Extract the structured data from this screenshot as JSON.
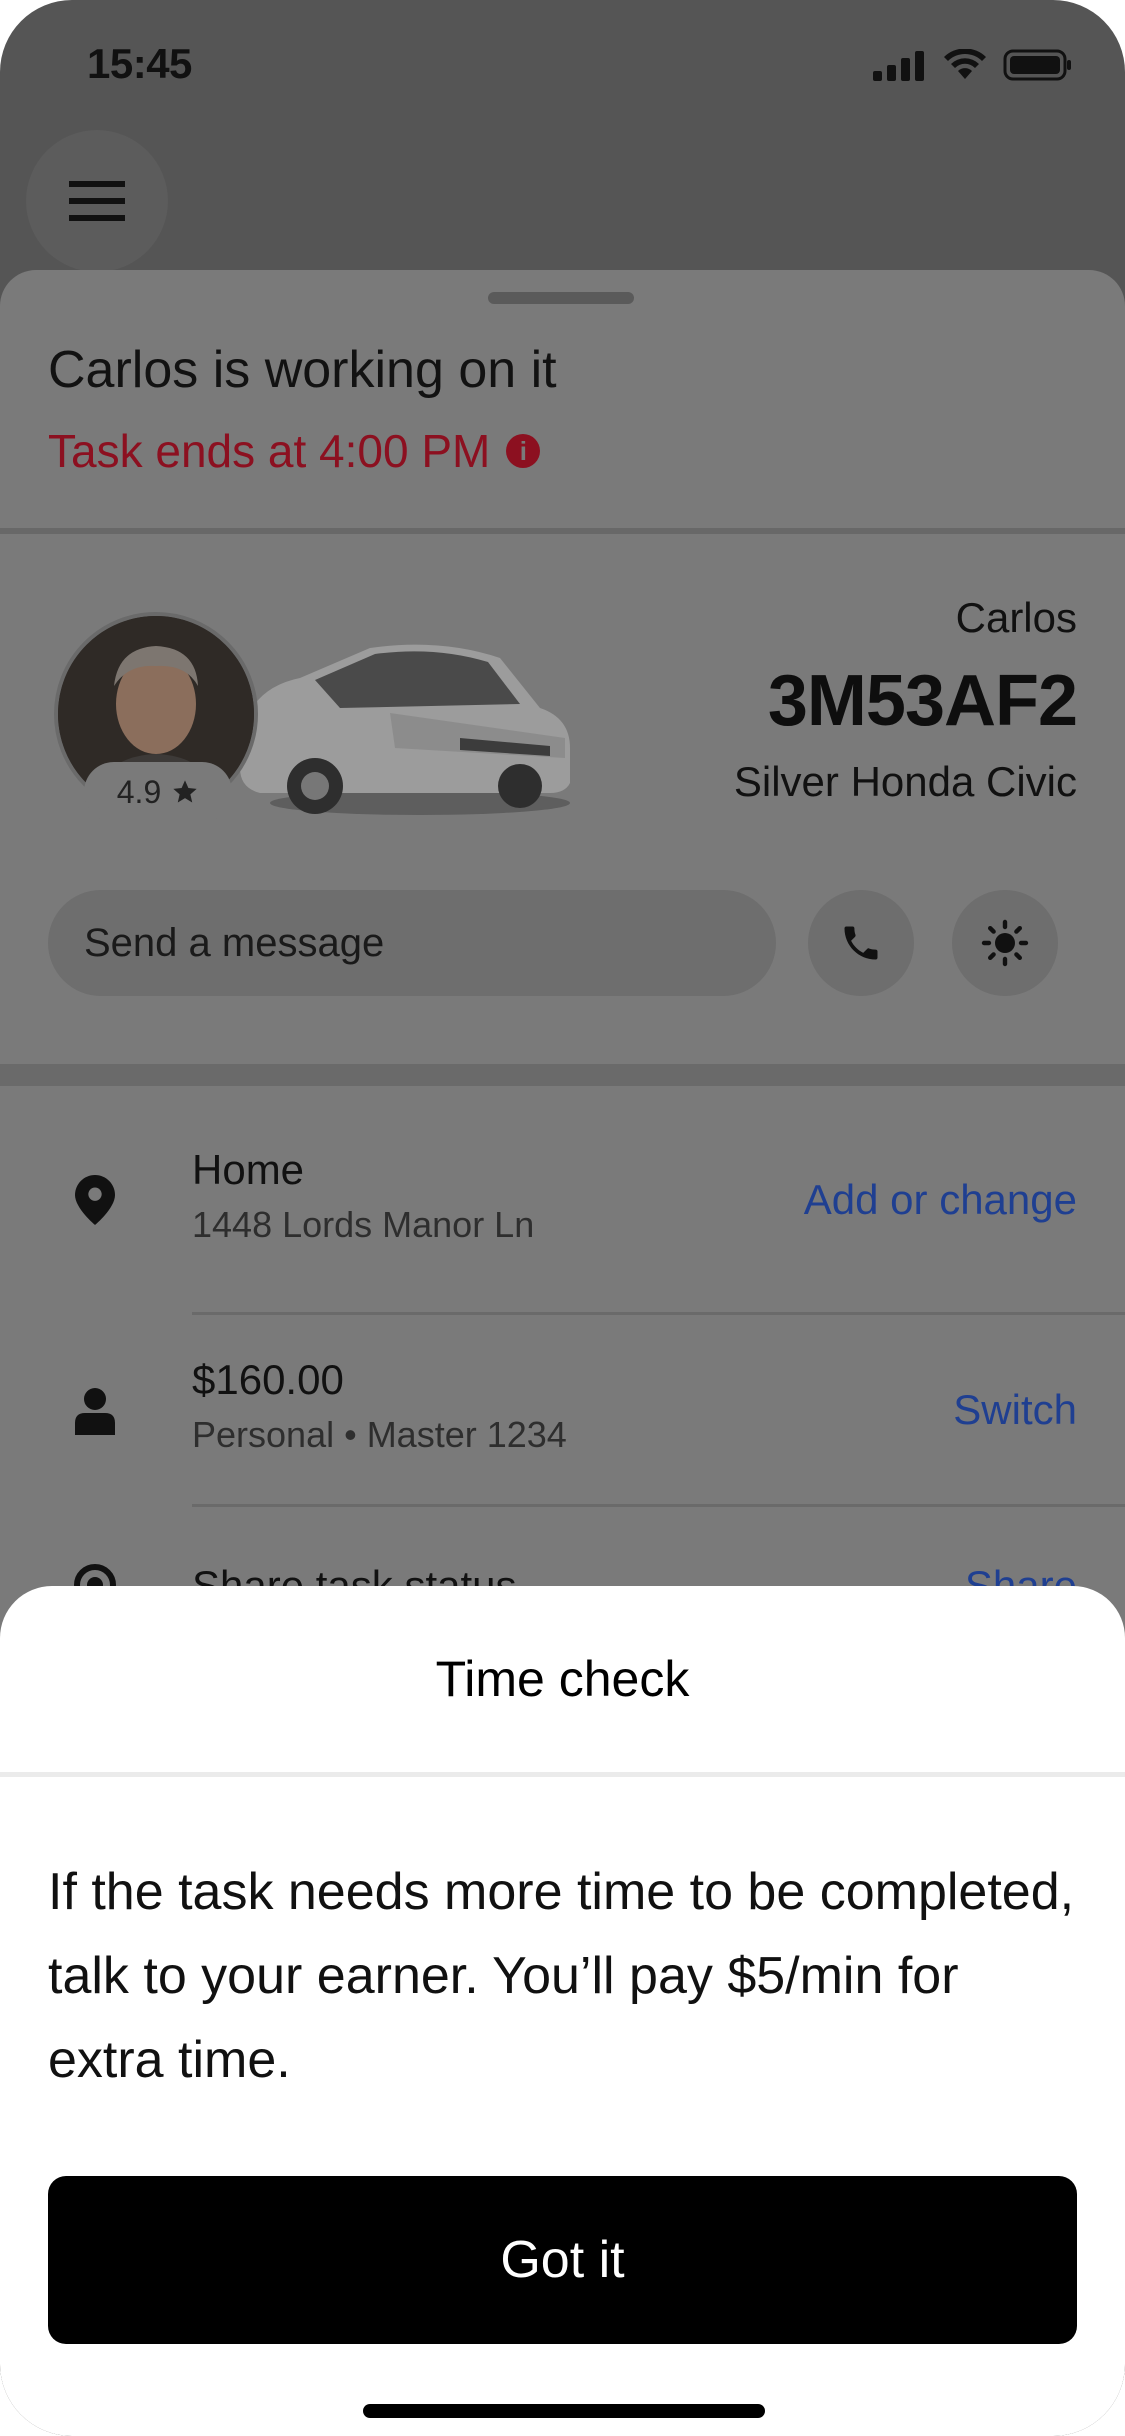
{
  "status_bar": {
    "time": "15:45",
    "signal_icon": "signal-icon",
    "wifi_icon": "wifi-icon",
    "battery_icon": "battery-icon"
  },
  "header": {
    "menu_icon": "hamburger-menu-icon"
  },
  "trip": {
    "title": "Carlos is working on it",
    "subtitle": "Task ends at 4:00 PM",
    "subtitle_color": "#8c1020"
  },
  "driver": {
    "name": "Carlos",
    "rating": "4.9",
    "plate": "3M53AF2",
    "vehicle": "Silver Honda Civic"
  },
  "contact": {
    "message_placeholder": "Send a message",
    "call_icon": "phone-icon",
    "safety_icon": "safety-shield-icon"
  },
  "rows": [
    {
      "icon": "location-pin-icon",
      "title": "Home",
      "subtitle": "1448 Lords Manor Ln",
      "action": "Add or change"
    },
    {
      "icon": "person-icon",
      "title": "$160.00",
      "subtitle": "Personal • Master 1234",
      "action": "Switch"
    },
    {
      "icon": "share-status-icon",
      "title": "Share task status",
      "action": "Share"
    }
  ],
  "modal": {
    "title": "Time check",
    "body": "If the task needs more time to be completed, talk to your earner. You’ll pay $5/min for extra time.",
    "button": "Got it"
  },
  "colors": {
    "link": "#1f3f91",
    "primary_button": "#000000",
    "overlay": "#555555"
  }
}
